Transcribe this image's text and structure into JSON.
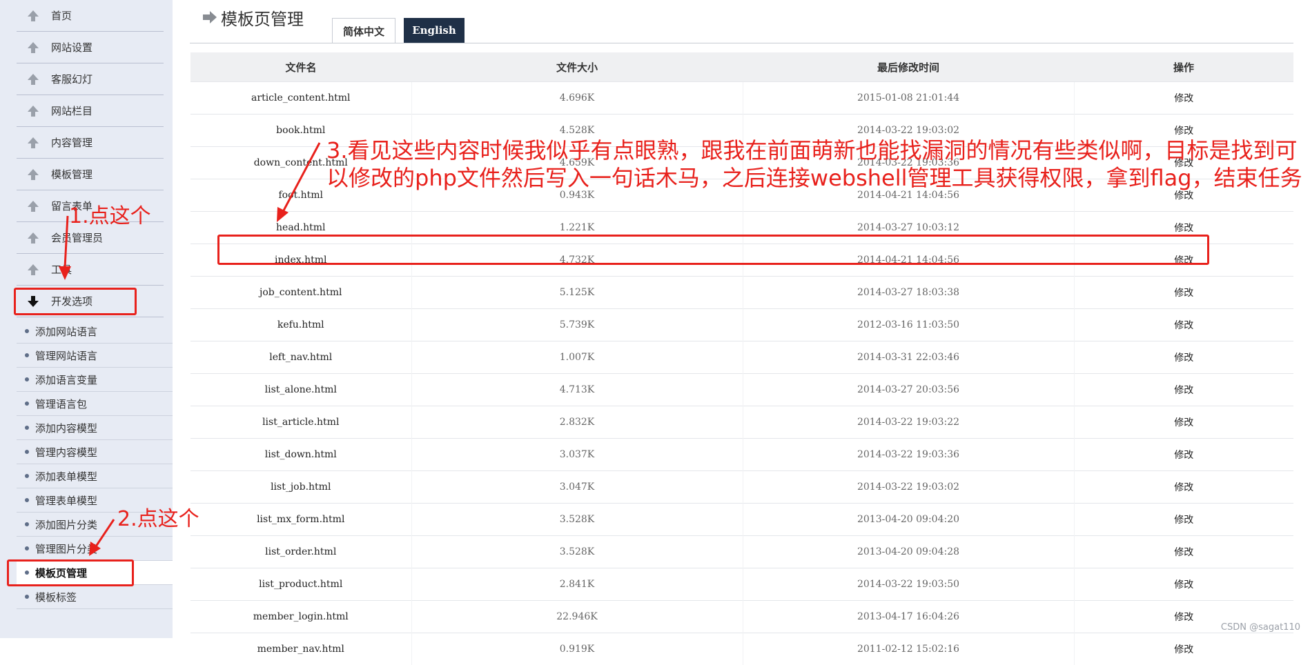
{
  "sidebar": {
    "main_items": [
      {
        "label": "首页"
      },
      {
        "label": "网站设置"
      },
      {
        "label": "客服幻灯"
      },
      {
        "label": "网站栏目"
      },
      {
        "label": "内容管理"
      },
      {
        "label": "模板管理"
      },
      {
        "label": "留言表单"
      },
      {
        "label": "会员管理员"
      },
      {
        "label": "工具"
      },
      {
        "label": "开发选项"
      }
    ],
    "sub_items": [
      {
        "label": "添加网站语言"
      },
      {
        "label": "管理网站语言"
      },
      {
        "label": "添加语言变量"
      },
      {
        "label": "管理语言包"
      },
      {
        "label": "添加内容模型"
      },
      {
        "label": "管理内容模型"
      },
      {
        "label": "添加表单模型"
      },
      {
        "label": "管理表单模型"
      },
      {
        "label": "添加图片分类"
      },
      {
        "label": "管理图片分类"
      },
      {
        "label": "模板页管理"
      },
      {
        "label": "模板标签"
      }
    ],
    "active_sub_item": "模板页管理"
  },
  "header": {
    "title": "模板页管理",
    "tabs": [
      {
        "label": "简体中文",
        "active": true
      },
      {
        "label": "English",
        "active": false
      }
    ]
  },
  "table": {
    "columns": [
      "文件名",
      "文件大小",
      "最后修改时间",
      "操作"
    ],
    "rows": [
      {
        "name": "article_content.html",
        "size": "4.696K",
        "time": "2015-01-08 21:01:44",
        "action": "修改"
      },
      {
        "name": "book.html",
        "size": "4.528K",
        "time": "2014-03-22 19:03:02",
        "action": "修改"
      },
      {
        "name": "down_content.html",
        "size": "4.659K",
        "time": "2014-03-22 19:03:36",
        "action": "修改"
      },
      {
        "name": "foot.html",
        "size": "0.943K",
        "time": "2014-04-21 14:04:56",
        "action": "修改"
      },
      {
        "name": "head.html",
        "size": "1.221K",
        "time": "2014-03-27 10:03:12",
        "action": "修改"
      },
      {
        "name": "index.html",
        "size": "4.732K",
        "time": "2014-04-21 14:04:56",
        "action": "修改"
      },
      {
        "name": "job_content.html",
        "size": "5.125K",
        "time": "2014-03-27 18:03:38",
        "action": "修改"
      },
      {
        "name": "kefu.html",
        "size": "5.739K",
        "time": "2012-03-16 11:03:50",
        "action": "修改"
      },
      {
        "name": "left_nav.html",
        "size": "1.007K",
        "time": "2014-03-31 22:03:46",
        "action": "修改"
      },
      {
        "name": "list_alone.html",
        "size": "4.713K",
        "time": "2014-03-27 20:03:56",
        "action": "修改"
      },
      {
        "name": "list_article.html",
        "size": "2.832K",
        "time": "2014-03-22 19:03:22",
        "action": "修改"
      },
      {
        "name": "list_down.html",
        "size": "3.037K",
        "time": "2014-03-22 19:03:36",
        "action": "修改"
      },
      {
        "name": "list_job.html",
        "size": "3.047K",
        "time": "2014-03-22 19:03:02",
        "action": "修改"
      },
      {
        "name": "list_mx_form.html",
        "size": "3.528K",
        "time": "2013-04-20 09:04:20",
        "action": "修改"
      },
      {
        "name": "list_order.html",
        "size": "3.528K",
        "time": "2013-04-20 09:04:28",
        "action": "修改"
      },
      {
        "name": "list_product.html",
        "size": "2.841K",
        "time": "2014-03-22 19:03:50",
        "action": "修改"
      },
      {
        "name": "member_login.html",
        "size": "22.946K",
        "time": "2013-04-17 16:04:26",
        "action": "修改"
      },
      {
        "name": "member_nav.html",
        "size": "0.919K",
        "time": "2011-02-12 15:02:16",
        "action": "修改"
      }
    ]
  },
  "annotations": {
    "step1": "1.点这个",
    "step2": "2.点这个",
    "step3": "3.看见这些内容时候我似乎有点眼熟，跟我在前面萌新也能找漏洞的情况有些类似啊，目标是找到可以修改的php文件然后写入一句话木马，之后连接webshell管理工具获得权限，拿到flag，结束任务",
    "color": "#e8211c"
  },
  "watermark": "CSDN @sagat110",
  "colors": {
    "sidebar_bg": "#e7ebf4",
    "tab_en_bg": "#1f3047",
    "table_header_bg": "#eff0f2"
  }
}
